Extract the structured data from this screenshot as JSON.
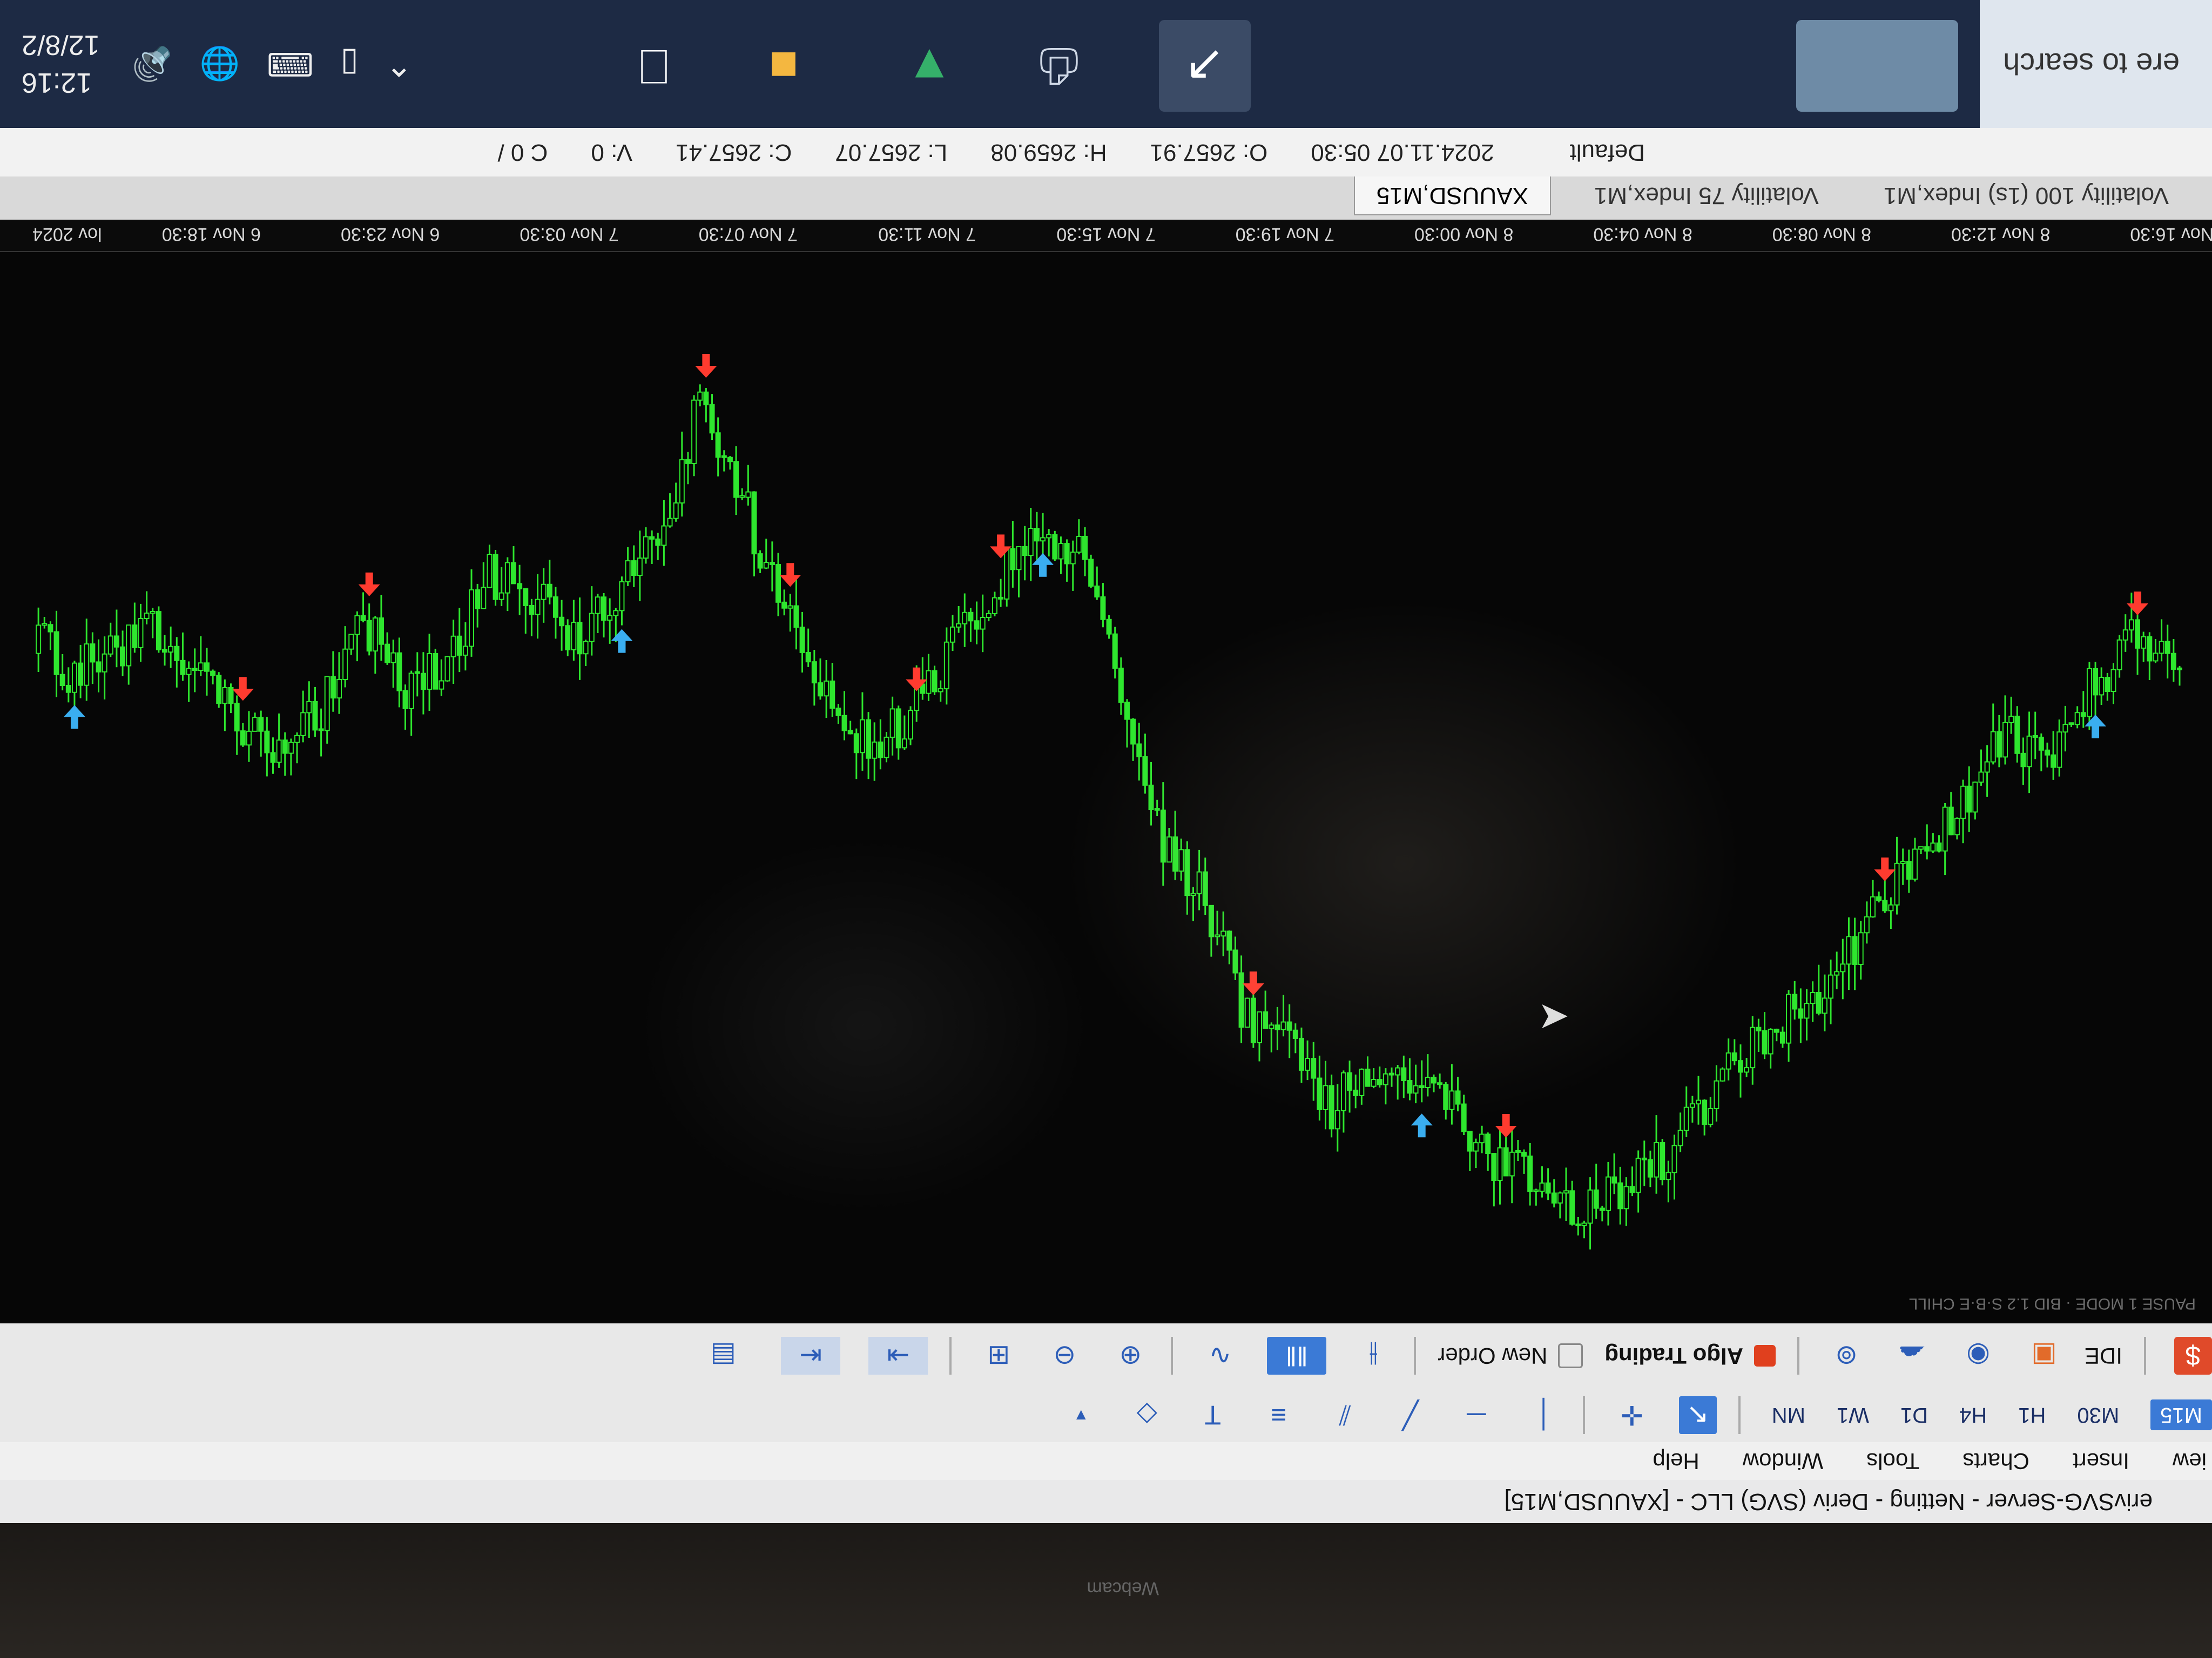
{
  "window": {
    "title": "erivSVG-Server - Netting - Deriv (SVG) LLC - [XAUUSD,M15]"
  },
  "menu": {
    "items": [
      "iew",
      "Insert",
      "Charts",
      "Tools",
      "Window",
      "Help"
    ]
  },
  "timeframes": {
    "items": [
      "M15",
      "M30",
      "H1",
      "H4",
      "D1",
      "W1",
      "MN"
    ],
    "active": "M15"
  },
  "toolbar": {
    "ide": "IDE",
    "algo_trading": "Algo Trading",
    "new_order": "New Order"
  },
  "chart": {
    "symbol_tab": "XAUUSD,M15",
    "corner_text": "PAUSE 1 MODE · BID 1.2 S·B·E CHILL",
    "bull_color": "#2ee62e",
    "bear_color": "#2ee62e",
    "buy_arrow_color": "#ff3b2f",
    "sell_arrow_color": "#3aaef0"
  },
  "chart_data": {
    "type": "candlestick",
    "x": [
      "lov 2024",
      "6 Nov 18:30",
      "6 Nov 23:30",
      "7 Nov 03:30",
      "7 Nov 07:30",
      "7 Nov 11:30",
      "7 Nov 15:30",
      "7 Nov 19:30",
      "8 Nov 00:30",
      "8 Nov 04:30",
      "8 Nov 08:30",
      "8 Nov 12:30",
      "8 Nov 16:30"
    ],
    "close_series": [
      0.38,
      0.35,
      0.4,
      0.47,
      0.45,
      0.52,
      0.58,
      0.63,
      0.7,
      0.74,
      0.77,
      0.83,
      0.89,
      0.92,
      0.95,
      0.93,
      0.9,
      0.85,
      0.82,
      0.8,
      0.84,
      0.78,
      0.75,
      0.62,
      0.56,
      0.4,
      0.26,
      0.23,
      0.29,
      0.36,
      0.43,
      0.46,
      0.41,
      0.32,
      0.2,
      0.1,
      0.24,
      0.31,
      0.35,
      0.3,
      0.28,
      0.37,
      0.4,
      0.33,
      0.42,
      0.46,
      0.44,
      0.38,
      0.34,
      0.36,
      0.39,
      0.33
    ],
    "buy_signal_indices": [
      1,
      7,
      16,
      22,
      28,
      30,
      33,
      35,
      43,
      46
    ],
    "sell_signal_indices": [
      2,
      18,
      27,
      37,
      50
    ],
    "grid": false
  },
  "tabs": {
    "items": [
      "Volatility 100 (1s) Index,M1",
      "Volatility 75 Index,M1",
      "XAUUSD,M15"
    ],
    "active": 2
  },
  "status": {
    "profile": "Default",
    "datetime": "2024.11.07 05:30",
    "open": "O: 2657.91",
    "high": "H: 2659.08",
    "low": "L: 2657.07",
    "close": "C: 2657.41",
    "volume": "V: 0",
    "extra": "C 0 /"
  },
  "taskbar": {
    "search_placeholder": "ere to search",
    "time": "12:16",
    "date": "12/8/2"
  },
  "bezel": {
    "webcam_label": "Webcam"
  }
}
